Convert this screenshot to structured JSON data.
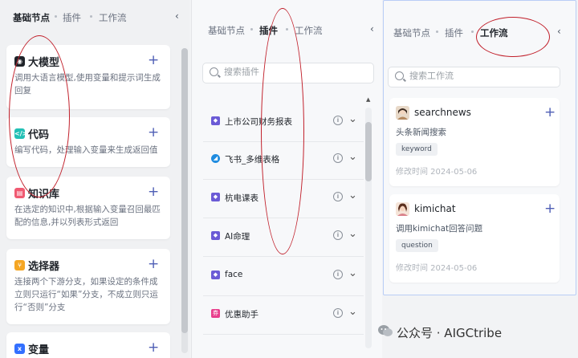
{
  "nodes_panel": {
    "tabs": [
      "基础节点",
      "插件",
      "工作流"
    ],
    "collapse_glyph": "‹",
    "cards": [
      {
        "title": "大模型",
        "desc": "调用大语言模型,使用变量和提示词生成回复",
        "icon": "llm-icon",
        "color": "#1f2329"
      },
      {
        "title": "代码",
        "desc": "编写代码，处理输入变量来生成返回值",
        "icon": "code-icon",
        "color": "#23c0b5"
      },
      {
        "title": "知识库",
        "desc": "在选定的知识中,根据输入变量召回最匹配的信息,并以列表形式返回",
        "icon": "knowledge-icon",
        "color": "#f05a72"
      },
      {
        "title": "选择器",
        "desc": "连接两个下游分支，如果设定的条件成立则只运行“如果”分支，不成立则只运行“否则”分支",
        "icon": "selector-icon",
        "color": "#f5a623"
      },
      {
        "title": "变量",
        "desc": "",
        "icon": "variable-icon",
        "color": "#3370ff"
      }
    ]
  },
  "plugins_panel": {
    "tabs": [
      "基础节点",
      "插件",
      "工作流"
    ],
    "collapse_glyph": "‹",
    "search_placeholder": "搜索插件",
    "plugins": [
      {
        "name": "上市公司财务报表",
        "icon": "plugin-icon",
        "color": "#6b5bd6"
      },
      {
        "name": "飞书_多维表格",
        "icon": "feishu-icon",
        "color": "#1f8ce0"
      },
      {
        "name": "杭电课表",
        "icon": "plugin-icon",
        "color": "#6b5bd6"
      },
      {
        "name": "AI命理",
        "icon": "plugin-icon",
        "color": "#6b5bd6"
      },
      {
        "name": "face",
        "icon": "plugin-icon",
        "color": "#6b5bd6"
      },
      {
        "name": "优惠助手",
        "icon": "coupon-icon",
        "color": "#e83e8c"
      }
    ]
  },
  "workflows_panel": {
    "tabs": [
      "基础节点",
      "插件",
      "工作流"
    ],
    "collapse_glyph": "‹",
    "search_placeholder": "搜索工作流",
    "workflows": [
      {
        "name": "searchnews",
        "desc": "头条新闻搜索",
        "tag": "keyword",
        "time": "修改时间 2024-05-06"
      },
      {
        "name": "kimichat",
        "desc": "调用kimichat回答问题",
        "tag": "question",
        "time": "修改时间 2024-05-06"
      }
    ]
  },
  "watermark": {
    "text": "公众号 · AIGCtribe"
  },
  "colors": {
    "accent_plus": "#4e5eb5",
    "annotation": "#c11f2a",
    "panel_border_active": "#b9cdf6"
  }
}
